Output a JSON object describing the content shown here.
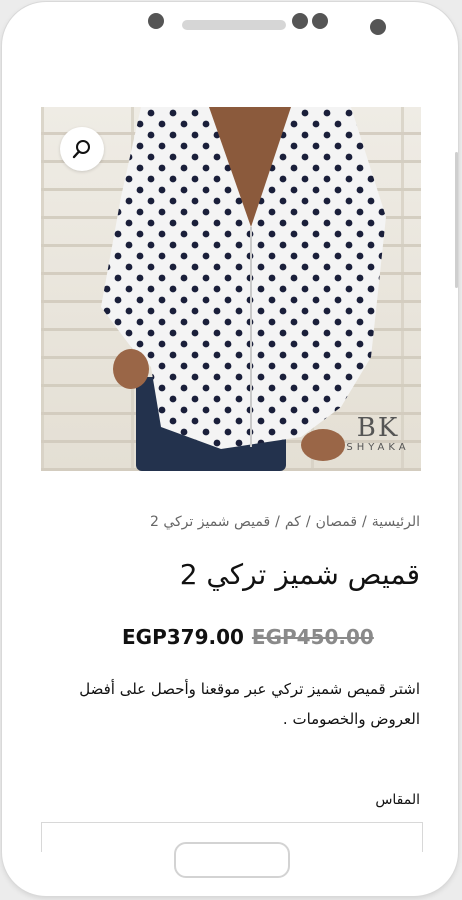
{
  "product": {
    "breadcrumb": [
      "الرئيسية",
      "قمصان",
      "كم",
      "قميص شميز تركي 2"
    ],
    "breadcrumb_sep": "/",
    "title": "قميص شميز تركي 2",
    "price_sale": "EGP379.00",
    "price_regular": "EGP450.00",
    "description": "اشتر قميص شميز تركي عبر موقعنا وأحصل على أفضل العروض والخصومات .",
    "size_label": "المقاس"
  },
  "image": {
    "alt": "قميص أبيض منقط",
    "logo_mark": "BK",
    "logo_word": "SHYAKA"
  },
  "colors": {
    "price_old": "#8a8a8a",
    "text": "#111111"
  }
}
